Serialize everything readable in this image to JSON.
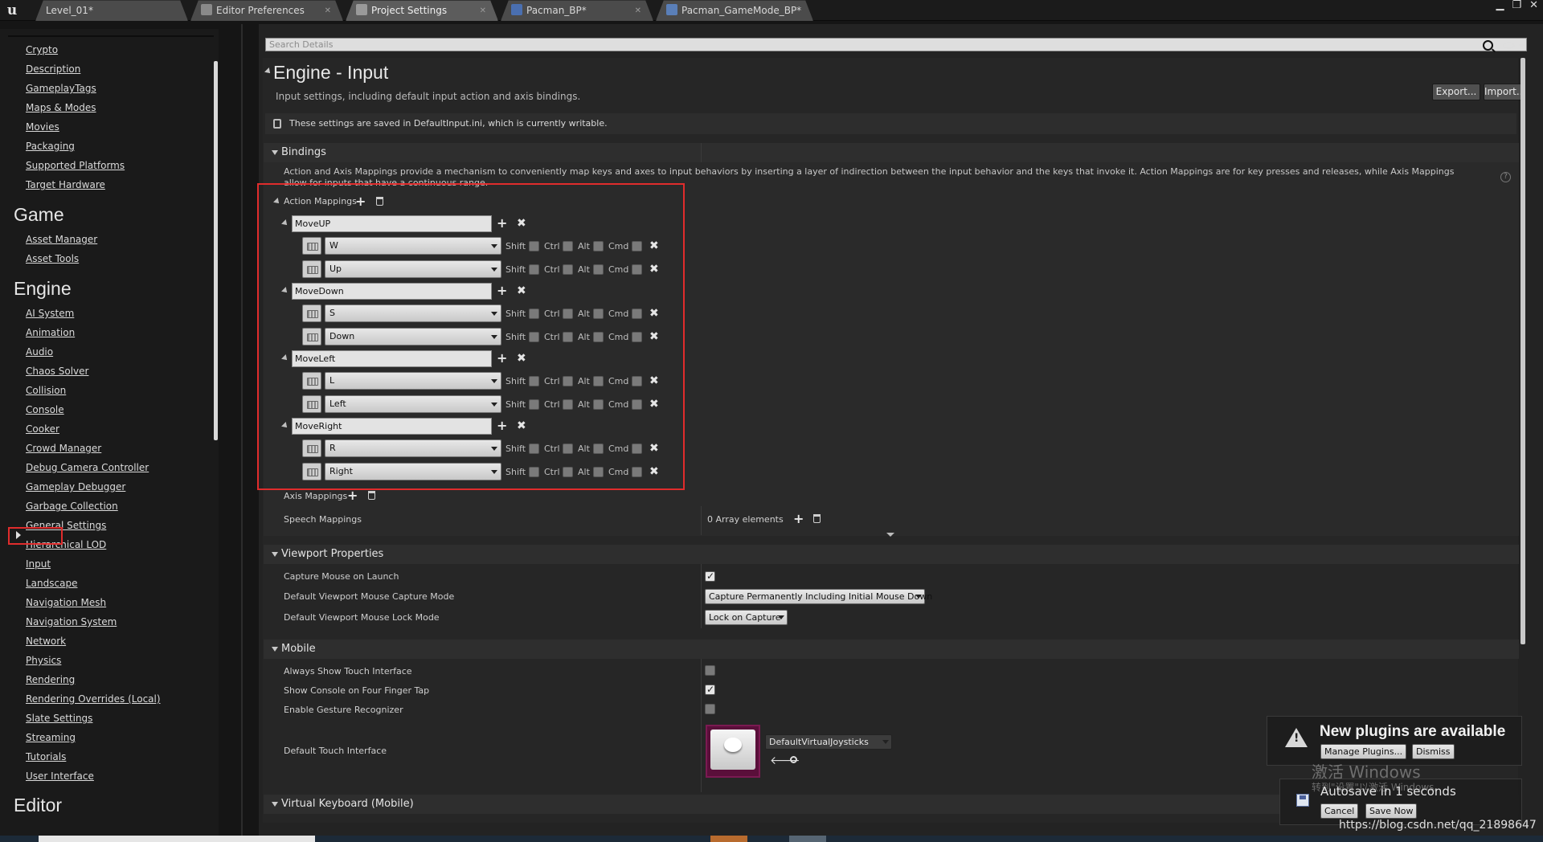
{
  "tabs": [
    {
      "label": "Level_01*"
    },
    {
      "label": "Editor Preferences"
    },
    {
      "label": "Project Settings"
    },
    {
      "label": "Pacman_BP*"
    },
    {
      "label": "Pacman_GameMode_BP*"
    }
  ],
  "nav": {
    "items_top": [
      "Crypto",
      "Description",
      "GameplayTags",
      "Maps & Modes",
      "Movies",
      "Packaging",
      "Supported Platforms",
      "Target Hardware"
    ],
    "game_header": "Game",
    "game_items": [
      "Asset Manager",
      "Asset Tools"
    ],
    "engine_header": "Engine",
    "engine_items": [
      "AI System",
      "Animation",
      "Audio",
      "Chaos Solver",
      "Collision",
      "Console",
      "Cooker",
      "Crowd Manager",
      "Debug Camera Controller",
      "Gameplay Debugger",
      "Garbage Collection",
      "General Settings",
      "Hierarchical LOD",
      "Input",
      "Landscape",
      "Navigation Mesh",
      "Navigation System",
      "Network",
      "Physics",
      "Rendering",
      "Rendering Overrides (Local)",
      "Slate Settings",
      "Streaming",
      "Tutorials",
      "User Interface"
    ],
    "editor_header": "Editor"
  },
  "search": {
    "placeholder": "Search Details"
  },
  "header": {
    "title": "Engine - Input",
    "description": "Input settings, including default input action and axis bindings.",
    "export_label": "Export...",
    "import_label": "Import..."
  },
  "info": {
    "text": "These settings are saved in DefaultInput.ini, which is currently writable."
  },
  "bindings": {
    "title": "Bindings",
    "description": "Action and Axis Mappings provide a mechanism to conveniently map keys and axes to input behaviors by inserting a layer of indirection between the input behavior and the keys that invoke it. Action Mappings are for key presses and releases, while Axis Mappings allow for inputs that have a continuous range.",
    "action_mappings_label": "Action Mappings",
    "modifiers": [
      "Shift",
      "Ctrl",
      "Alt",
      "Cmd"
    ],
    "actions": [
      {
        "name": "MoveUP",
        "keys": [
          "W",
          "Up"
        ]
      },
      {
        "name": "MoveDown",
        "keys": [
          "S",
          "Down"
        ]
      },
      {
        "name": "MoveLeft",
        "keys": [
          "L",
          "Left"
        ]
      },
      {
        "name": "MoveRight",
        "keys": [
          "R",
          "Right"
        ]
      }
    ],
    "axis_mappings_label": "Axis Mappings",
    "speech_mappings_label": "Speech Mappings",
    "speech_mappings_value": "0 Array elements"
  },
  "viewport": {
    "title": "Viewport Properties",
    "capture_mouse_label": "Capture Mouse on Launch",
    "capture_mode_label": "Default Viewport Mouse Capture Mode",
    "capture_mode_value": "Capture Permanently Including Initial Mouse Down",
    "lock_mode_label": "Default Viewport Mouse Lock Mode",
    "lock_mode_value": "Lock on Capture"
  },
  "mobile": {
    "title": "Mobile",
    "always_show_touch_label": "Always Show Touch Interface",
    "show_console_label": "Show Console on Four Finger Tap",
    "gesture_label": "Enable Gesture Recognizer",
    "touch_interface_label": "Default Touch Interface",
    "touch_interface_value": "DefaultVirtualJoysticks"
  },
  "virtual_keyboard": {
    "title": "Virtual Keyboard (Mobile)"
  },
  "notification": {
    "title": "New plugins are available",
    "manage_label": "Manage Plugins...",
    "dismiss_label": "Dismiss"
  },
  "watermark": {
    "line1": "激活 Windows",
    "line2": "转到\"设置\"以激活 Windows。"
  },
  "autosave": {
    "text": "Autosave in 1 seconds",
    "cancel_label": "Cancel",
    "save_label": "Save Now"
  },
  "url": "https://blog.csdn.net/qq_21898647",
  "colors": {
    "highlight": "#e02c2c",
    "background": "#232323",
    "accent_thumb": "#5a0f3a"
  }
}
